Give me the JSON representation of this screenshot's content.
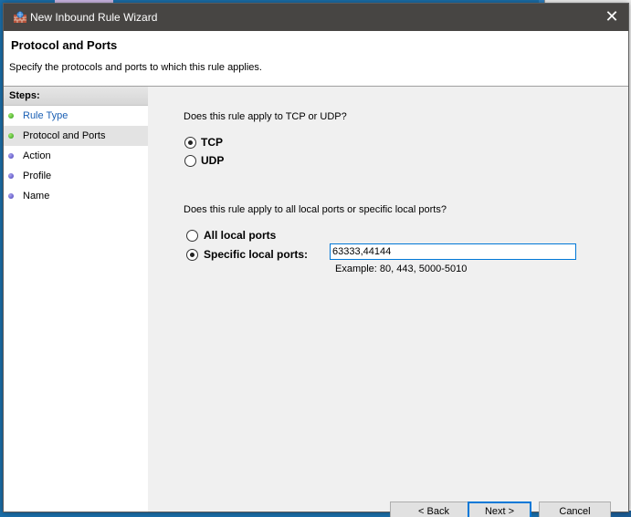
{
  "window": {
    "title": "New Inbound Rule Wizard",
    "close_glyph": "✕"
  },
  "header": {
    "title": "Protocol and Ports",
    "description": "Specify the protocols and ports to which this rule applies."
  },
  "steps": {
    "title": "Steps:",
    "items": [
      {
        "label": "Rule Type",
        "state": "done"
      },
      {
        "label": "Protocol and Ports",
        "state": "current"
      },
      {
        "label": "Action",
        "state": "pending"
      },
      {
        "label": "Profile",
        "state": "pending"
      },
      {
        "label": "Name",
        "state": "pending"
      }
    ]
  },
  "protocol": {
    "question": "Does this rule apply to TCP or UDP?",
    "options": [
      {
        "label": "TCP",
        "checked": true
      },
      {
        "label": "UDP",
        "checked": false
      }
    ]
  },
  "ports": {
    "question": "Does this rule apply to all local ports or specific local ports?",
    "options": [
      {
        "label": "All local ports",
        "checked": false
      },
      {
        "label": "Specific local ports:",
        "checked": true
      }
    ],
    "value": "63333,44144",
    "example": "Example: 80, 443, 5000-5010"
  },
  "buttons": {
    "back": "< Back",
    "next": "Next >",
    "cancel": "Cancel"
  },
  "colors": {
    "titlebar": "#474543",
    "accent": "#0078d7",
    "link": "#1a5fb4"
  }
}
